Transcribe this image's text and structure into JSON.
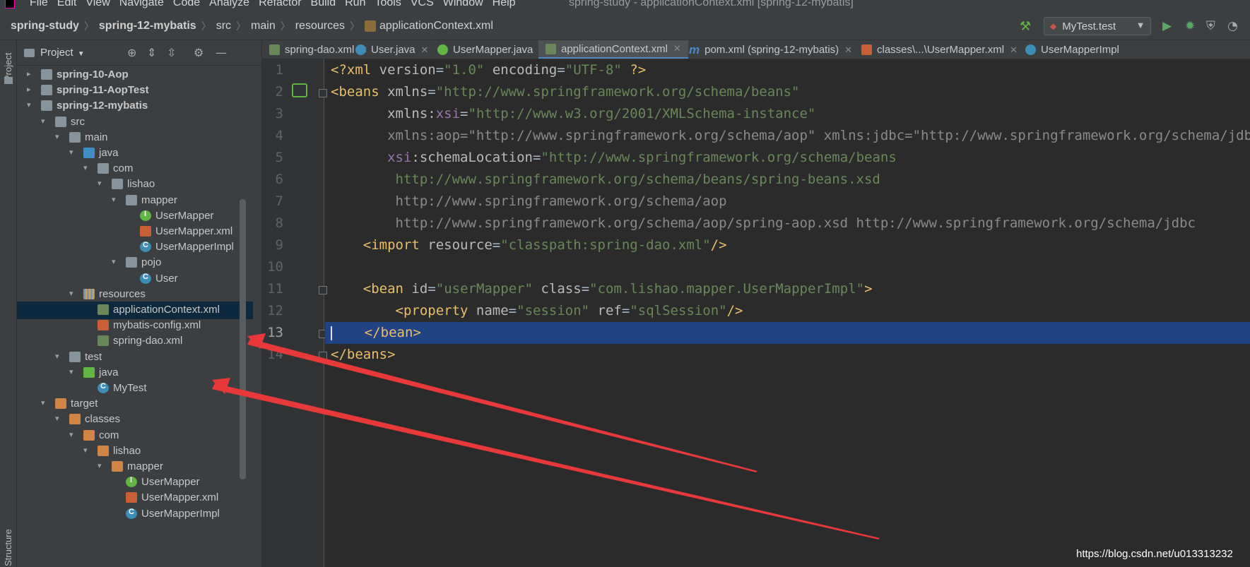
{
  "menubar": {
    "items": [
      "File",
      "Edit",
      "View",
      "Navigate",
      "Code",
      "Analyze",
      "Refactor",
      "Build",
      "Run",
      "Tools",
      "VCS",
      "Window",
      "Help"
    ],
    "window_title": "spring-study - applicationContext.xml [spring-12-mybatis]"
  },
  "navbar": {
    "crumbs": [
      "spring-study",
      "spring-12-mybatis",
      "src",
      "main",
      "resources",
      "applicationContext.xml"
    ],
    "run_config": "MyTest.test"
  },
  "leftstripe": {
    "project_label": "Project",
    "structure_label": "Structure"
  },
  "project_panel": {
    "title": "Project",
    "tree": [
      {
        "label": "spring-10-Aop",
        "depth": 0,
        "expanded": false,
        "icon": "module",
        "bold": true
      },
      {
        "label": "spring-11-AopTest",
        "depth": 0,
        "expanded": false,
        "icon": "module",
        "bold": true
      },
      {
        "label": "spring-12-mybatis",
        "depth": 0,
        "expanded": true,
        "icon": "module",
        "bold": true
      },
      {
        "label": "src",
        "depth": 1,
        "expanded": true,
        "icon": "folder"
      },
      {
        "label": "main",
        "depth": 2,
        "expanded": true,
        "icon": "folder"
      },
      {
        "label": "java",
        "depth": 3,
        "expanded": true,
        "icon": "folder-src"
      },
      {
        "label": "com",
        "depth": 4,
        "expanded": true,
        "icon": "pkg"
      },
      {
        "label": "lishao",
        "depth": 5,
        "expanded": true,
        "icon": "pkg"
      },
      {
        "label": "mapper",
        "depth": 6,
        "expanded": true,
        "icon": "pkg"
      },
      {
        "label": "UserMapper",
        "depth": 7,
        "icon": "iface"
      },
      {
        "label": "UserMapper.xml",
        "depth": 7,
        "icon": "xml"
      },
      {
        "label": "UserMapperImpl",
        "depth": 7,
        "icon": "cls"
      },
      {
        "label": "pojo",
        "depth": 6,
        "expanded": true,
        "icon": "pkg"
      },
      {
        "label": "User",
        "depth": 7,
        "icon": "cls"
      },
      {
        "label": "resources",
        "depth": 3,
        "expanded": true,
        "icon": "folder-res"
      },
      {
        "label": "applicationContext.xml",
        "depth": 4,
        "icon": "spring-xml",
        "selected": true
      },
      {
        "label": "mybatis-config.xml",
        "depth": 4,
        "icon": "xml"
      },
      {
        "label": "spring-dao.xml",
        "depth": 4,
        "icon": "spring-xml"
      },
      {
        "label": "test",
        "depth": 2,
        "expanded": true,
        "icon": "folder"
      },
      {
        "label": "java",
        "depth": 3,
        "expanded": true,
        "icon": "folder-test"
      },
      {
        "label": "MyTest",
        "depth": 4,
        "icon": "cls"
      },
      {
        "label": "target",
        "depth": 1,
        "expanded": true,
        "icon": "folder-target"
      },
      {
        "label": "classes",
        "depth": 2,
        "expanded": true,
        "icon": "folder-target"
      },
      {
        "label": "com",
        "depth": 3,
        "expanded": true,
        "icon": "folder-target"
      },
      {
        "label": "lishao",
        "depth": 4,
        "expanded": true,
        "icon": "folder-target"
      },
      {
        "label": "mapper",
        "depth": 5,
        "expanded": true,
        "icon": "folder-target"
      },
      {
        "label": "UserMapper",
        "depth": 6,
        "icon": "iface"
      },
      {
        "label": "UserMapper.xml",
        "depth": 6,
        "icon": "xml"
      },
      {
        "label": "UserMapperImpl",
        "depth": 6,
        "icon": "cls"
      }
    ]
  },
  "tabs": [
    {
      "label": "spring-dao.xml",
      "icon": "spring-xml"
    },
    {
      "label": "User.java",
      "icon": "cls"
    },
    {
      "label": "UserMapper.java",
      "icon": "iface"
    },
    {
      "label": "applicationContext.xml",
      "icon": "spring-xml",
      "active": true
    },
    {
      "label": "pom.xml (spring-12-mybatis)",
      "icon": "maven"
    },
    {
      "label": "classes\\...\\UserMapper.xml",
      "icon": "xml"
    },
    {
      "label": "UserMapperImpl",
      "icon": "cls"
    }
  ],
  "editor": {
    "current_line": 13,
    "lines": [
      [
        [
          "t-tag",
          "<?xml "
        ],
        [
          "t-attr",
          "version"
        ],
        [
          "t-plain",
          "="
        ],
        [
          "t-val",
          "\"1.0\""
        ],
        [
          "t-plain",
          " "
        ],
        [
          "t-attr",
          "encoding"
        ],
        [
          "t-plain",
          "="
        ],
        [
          "t-val",
          "\"UTF-8\""
        ],
        [
          "t-plain",
          " "
        ],
        [
          "t-tag",
          "?>"
        ]
      ],
      [
        [
          "t-tag",
          "<beans "
        ],
        [
          "t-attr",
          "xmlns"
        ],
        [
          "t-plain",
          "="
        ],
        [
          "t-val",
          "\"http://www.springframework.org/schema/beans\""
        ]
      ],
      [
        [
          "t-plain",
          "       "
        ],
        [
          "t-attr",
          "xmlns:"
        ],
        [
          "t-ns",
          "xsi"
        ],
        [
          "t-plain",
          "="
        ],
        [
          "t-val",
          "\"http://www.w3.org/2001/XMLSchema-instance\""
        ]
      ],
      [
        [
          "t-plain",
          "       "
        ],
        [
          "t-gray",
          "xmlns:aop=\"http://www.springframework.org/schema/aop\" xmlns:jdbc=\"http://www.springframework.org/schema/jdbc\""
        ]
      ],
      [
        [
          "t-plain",
          "       "
        ],
        [
          "t-ns",
          "xsi"
        ],
        [
          "t-attr",
          ":schemaLocation"
        ],
        [
          "t-plain",
          "="
        ],
        [
          "t-val",
          "\"http://www.springframework.org/schema/beans"
        ]
      ],
      [
        [
          "t-val",
          "        http://www.springframework.org/schema/beans/spring-beans.xsd"
        ]
      ],
      [
        [
          "t-gray",
          "        http://www.springframework.org/schema/aop"
        ]
      ],
      [
        [
          "t-gray",
          "        http://www.springframework.org/schema/aop/spring-aop.xsd http://www.springframework.org/schema/jdbc"
        ]
      ],
      [
        [
          "t-plain",
          "    "
        ],
        [
          "t-tag",
          "<import "
        ],
        [
          "t-attr",
          "resource"
        ],
        [
          "t-plain",
          "="
        ],
        [
          "t-val",
          "\"classpath:spring-dao.xml\""
        ],
        [
          "t-tag",
          "/>"
        ]
      ],
      [],
      [
        [
          "t-plain",
          "    "
        ],
        [
          "t-tag",
          "<bean "
        ],
        [
          "t-attr",
          "id"
        ],
        [
          "t-plain",
          "="
        ],
        [
          "t-val",
          "\"userMapper\""
        ],
        [
          "t-plain",
          " "
        ],
        [
          "t-attr",
          "class"
        ],
        [
          "t-plain",
          "="
        ],
        [
          "t-val",
          "\"com.lishao.mapper.UserMapperImpl\""
        ],
        [
          "t-tag",
          ">"
        ]
      ],
      [
        [
          "t-plain",
          "        "
        ],
        [
          "t-tag",
          "<property "
        ],
        [
          "t-attr",
          "name"
        ],
        [
          "t-plain",
          "="
        ],
        [
          "t-val",
          "\"session\""
        ],
        [
          "t-plain",
          " "
        ],
        [
          "t-attr",
          "ref"
        ],
        [
          "t-plain",
          "="
        ],
        [
          "t-val",
          "\"sqlSession\""
        ],
        [
          "t-tag",
          "/>"
        ]
      ],
      [
        [
          "t-plain",
          "    "
        ],
        [
          "t-tag",
          "</bean>"
        ]
      ],
      [
        [
          "t-tag",
          "</beans>"
        ]
      ]
    ]
  },
  "watermark": "https://blog.csdn.net/u013313232",
  "colors": {
    "selection": "#214283",
    "arrow": "#e8393a",
    "accent": "#4a88c7"
  }
}
